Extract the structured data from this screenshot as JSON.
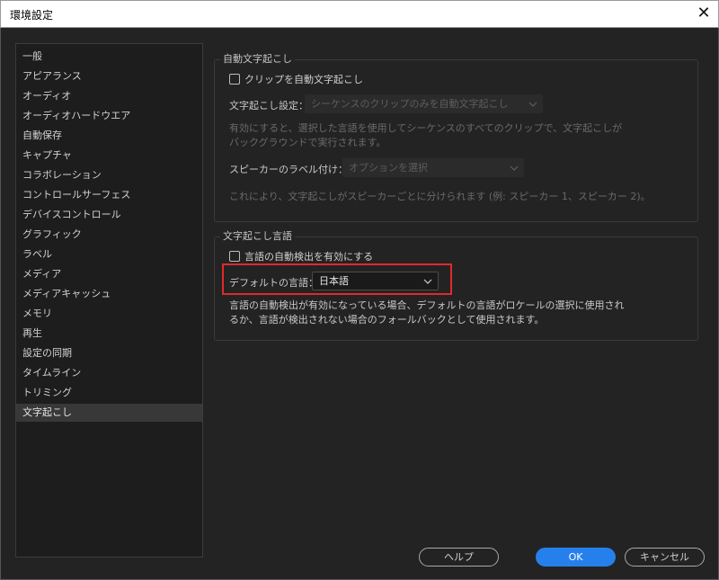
{
  "window": {
    "title": "環境設定"
  },
  "sidebar": {
    "items": [
      {
        "label": "一般"
      },
      {
        "label": "アピアランス"
      },
      {
        "label": "オーディオ"
      },
      {
        "label": "オーディオハードウエア"
      },
      {
        "label": "自動保存"
      },
      {
        "label": "キャプチャ"
      },
      {
        "label": "コラボレーション"
      },
      {
        "label": "コントロールサーフェス"
      },
      {
        "label": "デバイスコントロール"
      },
      {
        "label": "グラフィック"
      },
      {
        "label": "ラベル"
      },
      {
        "label": "メディア"
      },
      {
        "label": "メディアキャッシュ"
      },
      {
        "label": "メモリ"
      },
      {
        "label": "再生"
      },
      {
        "label": "設定の同期"
      },
      {
        "label": "タイムライン"
      },
      {
        "label": "トリミング"
      },
      {
        "label": "文字起こし"
      }
    ],
    "selected_index": 18
  },
  "auto_transcribe": {
    "legend": "自動文字起こし",
    "checkbox_label": "クリップを自動文字起こし",
    "setting_label": "文字起こし設定：",
    "setting_value": "シーケンスのクリップのみを自動文字起こし",
    "description": "有効にすると、選択した言語を使用してシーケンスのすべてのクリップで、文字起こしが バックグラウンドで実行されます。",
    "speaker_label": "スピーカーのラベル付け：",
    "speaker_value": "オプションを選択",
    "speaker_note": "これにより、文字起こしがスピーカーごとに分けられます (例: スピーカー 1、スピーカー 2)。"
  },
  "transcribe_language": {
    "legend": "文字起こし言語",
    "auto_detect_label": "言語の自動検出を有効にする",
    "default_label": "デフォルトの言語：",
    "default_value": "日本語",
    "description": "言語の自動検出が有効になっている場合、デフォルトの言語がロケールの選択に使用され るか、言語が検出されない場合のフォールバックとして使用されます。"
  },
  "footer": {
    "help_label": "ヘルプ",
    "ok_label": "OK",
    "cancel_label": "キャンセル"
  },
  "colors": {
    "accent": "#2680eb",
    "highlight": "#e02a2a",
    "background": "#232323"
  }
}
